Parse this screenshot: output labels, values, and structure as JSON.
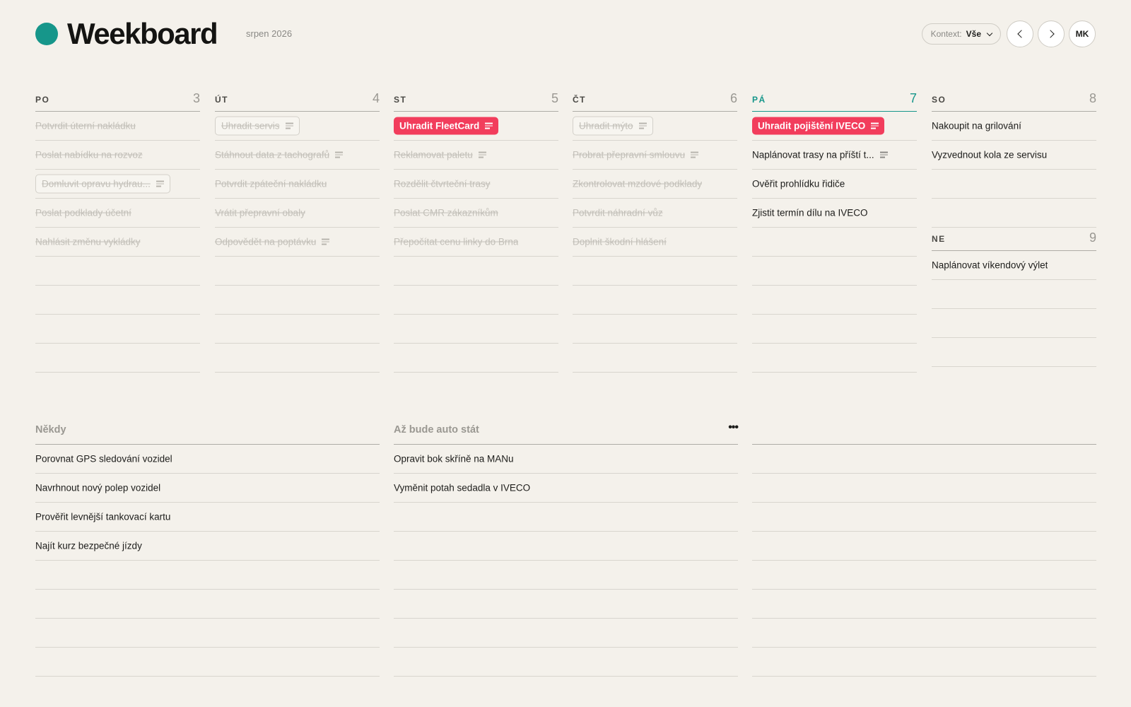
{
  "header": {
    "brand": "Weekboard",
    "month": "srpen 2026",
    "context_label": "Kontext:",
    "context_value": "Vše",
    "avatar": "MK"
  },
  "colors": {
    "accent": "#16968a",
    "highlight": "#f23d5c"
  },
  "days": [
    {
      "name": "PO",
      "num": "3",
      "tasks": [
        {
          "text": "Potvrdit úterní nakládku",
          "done": true
        },
        {
          "text": "Poslat nabídku na rozvoz",
          "done": true
        },
        {
          "text": "Domluvit opravu hydrau...",
          "done": true,
          "boxed": true,
          "note": true
        },
        {
          "text": "Poslat podklady účetní",
          "done": true
        },
        {
          "text": "Nahlásit změnu vykládky",
          "done": true
        }
      ]
    },
    {
      "name": "ÚT",
      "num": "4",
      "tasks": [
        {
          "text": "Uhradit servis",
          "done": true,
          "boxed": true,
          "note": true
        },
        {
          "text": "Stáhnout data z tachografů",
          "done": true,
          "note": true
        },
        {
          "text": "Potvrdit zpáteční nakládku",
          "done": true
        },
        {
          "text": "Vrátit přepravní obaly",
          "done": true
        },
        {
          "text": "Odpovědět na poptávku",
          "done": true,
          "note": true
        }
      ]
    },
    {
      "name": "ST",
      "num": "5",
      "tasks": [
        {
          "text": "Uhradit FleetCard",
          "hot": true,
          "note": true
        },
        {
          "text": "Reklamovat paletu",
          "done": true,
          "note": true
        },
        {
          "text": "Rozdělit čtvrteční trasy",
          "done": true
        },
        {
          "text": "Poslat CMR zákazníkům",
          "done": true
        },
        {
          "text": "Přepočítat cenu linky do Brna",
          "done": true
        }
      ]
    },
    {
      "name": "ČT",
      "num": "6",
      "tasks": [
        {
          "text": "Uhradit mýto",
          "done": true,
          "boxed": true,
          "note": true
        },
        {
          "text": "Probrat přepravní smlouvu",
          "done": true,
          "note": true
        },
        {
          "text": "Zkontrolovat mzdové podklady",
          "done": true
        },
        {
          "text": "Potvrdit náhradní vůz",
          "done": true
        },
        {
          "text": "Doplnit škodní hlášení",
          "done": true
        }
      ]
    },
    {
      "name": "PÁ",
      "num": "7",
      "today": true,
      "tasks": [
        {
          "text": "Uhradit pojištění IVECO",
          "hot": true,
          "note": true
        },
        {
          "text": "Naplánovat trasy na příští t...",
          "note": true
        },
        {
          "text": "Ověřit prohlídku řidiče"
        },
        {
          "text": "Zjistit termín dílu na IVECO"
        }
      ]
    }
  ],
  "weekend": {
    "sat": {
      "name": "SO",
      "num": "8",
      "tasks": [
        {
          "text": "Nakoupit na grilování"
        },
        {
          "text": "Vyzvednout kola ze servisu"
        }
      ]
    },
    "sun": {
      "name": "NE",
      "num": "9",
      "tasks": [
        {
          "text": "Naplánovat víkendový výlet"
        }
      ]
    }
  },
  "lists": [
    {
      "title": "Někdy",
      "tasks": [
        "Porovnat GPS sledování vozidel",
        "Navrhnout nový polep vozidel",
        "Prověřit levnější tankovací kartu",
        "Najít kurz bezpečné jízdy"
      ]
    },
    {
      "title": "Až bude auto stát",
      "tasks": [
        "Opravit bok skříně na MANu",
        "Vyměnit potah sedadla v IVECO"
      ]
    },
    {
      "title": "",
      "tasks": []
    }
  ]
}
